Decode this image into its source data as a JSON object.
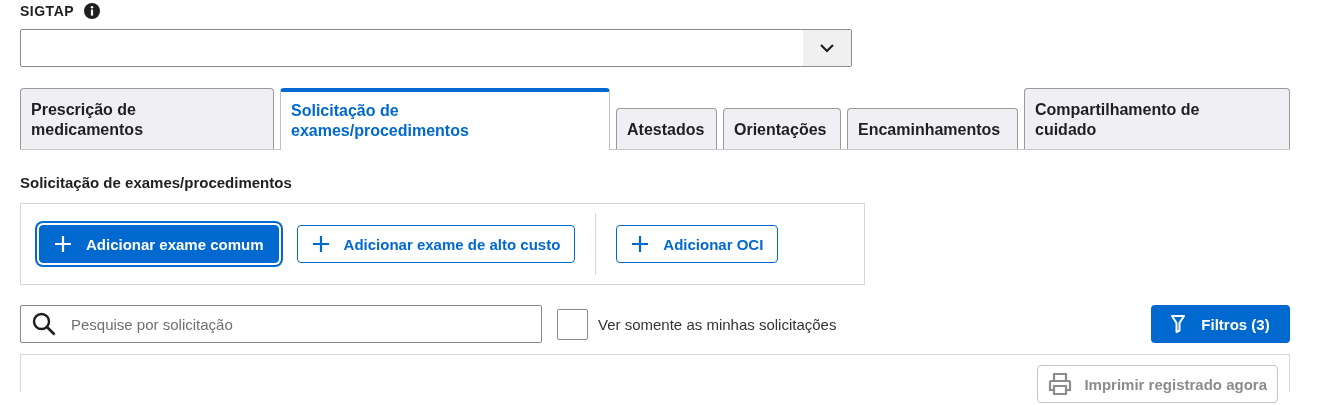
{
  "field": {
    "label": "SIGTAP"
  },
  "tabs": [
    {
      "label": "Prescrição de medicamentos",
      "selected": false
    },
    {
      "label": "Solicitação de exames/procedimentos",
      "selected": true
    },
    {
      "label": "Atestados",
      "selected": false
    },
    {
      "label": "Orientações",
      "selected": false
    },
    {
      "label": "Encaminhamentos",
      "selected": false
    },
    {
      "label": "Compartilhamento de cuidado",
      "selected": false
    }
  ],
  "section_title": "Solicitação de exames/procedimentos",
  "actions": [
    {
      "label": "Adicionar exame comum",
      "kind": "primary"
    },
    {
      "label": "Adicionar exame de alto custo",
      "kind": "outline"
    },
    {
      "label": "Adicionar OCI",
      "kind": "outline"
    }
  ],
  "search": {
    "placeholder": "Pesquise por solicitação"
  },
  "only_mine": {
    "label": "Ver somente as minhas solicitações",
    "checked": false
  },
  "filter_button": {
    "label": "Filtros (3)"
  },
  "print_button": {
    "label": "Imprimir registrado agora",
    "disabled": true
  }
}
